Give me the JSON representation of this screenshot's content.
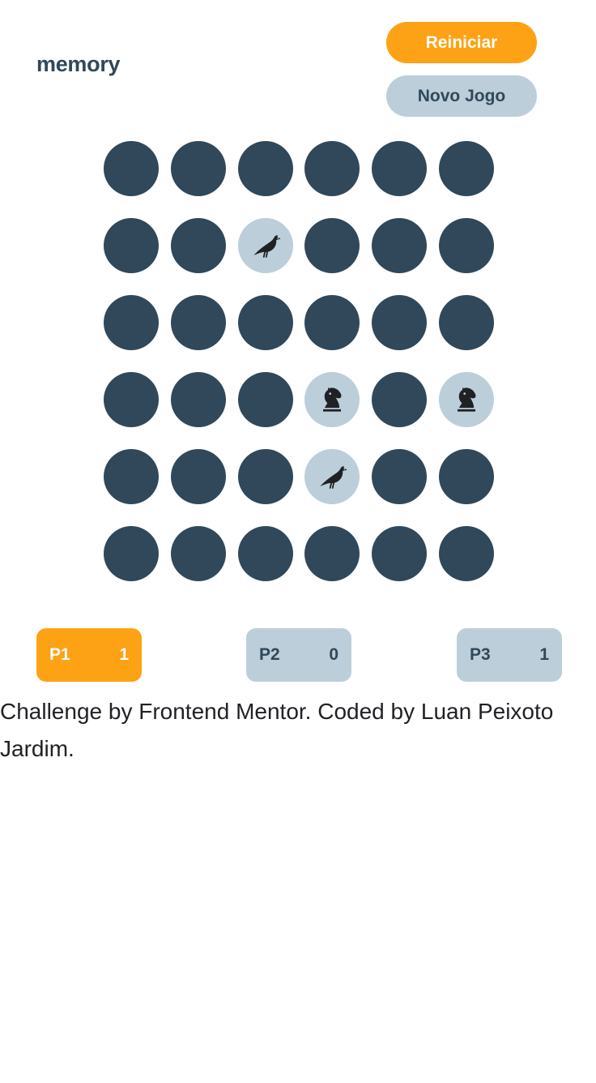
{
  "header": {
    "logo": "memory",
    "restart_label": "Reiniciar",
    "new_game_label": "Novo Jogo"
  },
  "board": {
    "rows": 6,
    "cols": 6,
    "revealed": [
      {
        "row": 2,
        "col": 3,
        "icon": "crow-icon"
      },
      {
        "row": 4,
        "col": 4,
        "icon": "chess-knight-icon"
      },
      {
        "row": 4,
        "col": 6,
        "icon": "chess-knight-icon"
      },
      {
        "row": 5,
        "col": 4,
        "icon": "crow-icon"
      }
    ]
  },
  "players": [
    {
      "name": "P1",
      "score": "1",
      "active": true
    },
    {
      "name": "P2",
      "score": "0",
      "active": false
    },
    {
      "name": "P3",
      "score": "1",
      "active": false
    }
  ],
  "footer": {
    "attribution": "Challenge by Frontend Mentor. Coded by Luan Peixoto Jardim."
  },
  "colors": {
    "accent": "#fda214",
    "tile_hidden": "#304859",
    "tile_revealed": "#bcced9",
    "text_dark": "#304859"
  }
}
